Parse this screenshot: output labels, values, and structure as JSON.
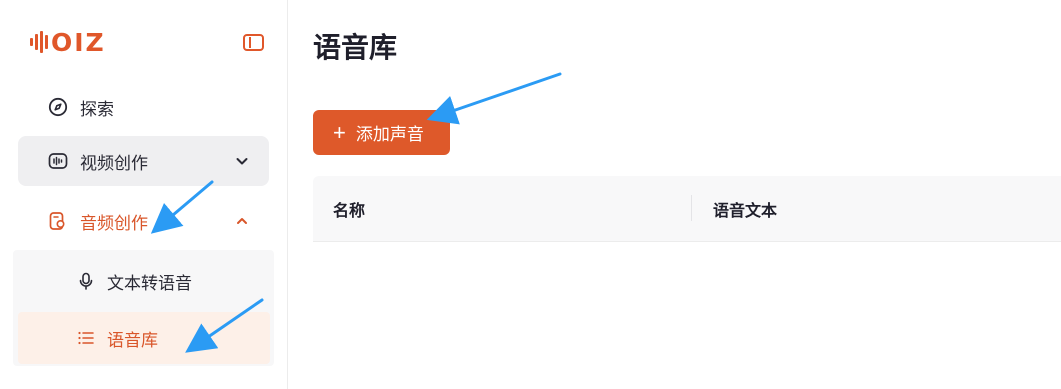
{
  "brand": {
    "name": "OIZ",
    "accent": "#de592a"
  },
  "sidebar": {
    "collapse_icon": "sidebar-toggle-icon",
    "items": [
      {
        "label": "探索",
        "icon": "compass-icon"
      },
      {
        "label": "视频创作",
        "icon": "video-waveform-icon",
        "expanded": false
      },
      {
        "label": "音频创作",
        "icon": "audio-create-icon",
        "expanded": true,
        "active": true
      }
    ],
    "submenu": [
      {
        "label": "文本转语音",
        "icon": "microphone-icon"
      },
      {
        "label": "语音库",
        "icon": "list-icon",
        "active": true
      }
    ]
  },
  "main": {
    "title": "语音库",
    "add_button": {
      "label": "添加声音",
      "icon": "plus-icon"
    },
    "table": {
      "columns": [
        "名称",
        "语音文本"
      ]
    }
  },
  "annotations": {
    "arrow_color": "#2b9bf4"
  }
}
